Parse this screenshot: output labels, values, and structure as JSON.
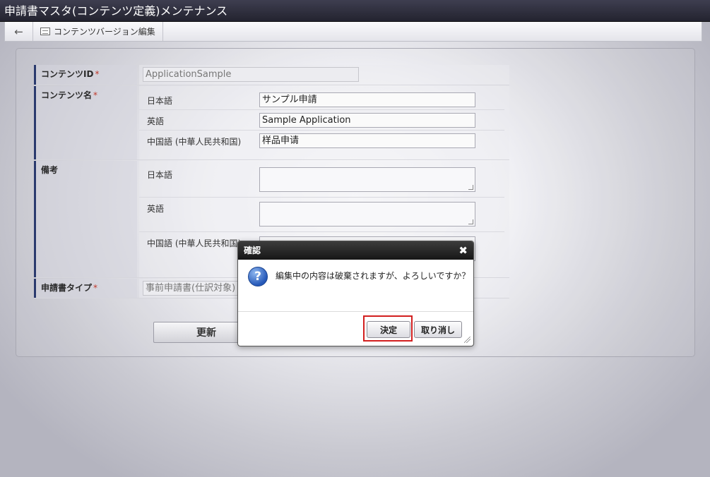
{
  "window": {
    "title": "申請書マスタ(コンテンツ定義)メンテナンス"
  },
  "toolbar": {
    "back_icon": "←",
    "tab_label": "コンテンツバージョン編集"
  },
  "form": {
    "content_id": {
      "label": "コンテンツID",
      "required_mark": "*",
      "value": "ApplicationSample"
    },
    "content_name": {
      "label": "コンテンツ名",
      "required_mark": "*",
      "langs": [
        {
          "label": "日本語",
          "value": "サンプル申請"
        },
        {
          "label": "英語",
          "value": "Sample Application"
        },
        {
          "label": "中国語 (中華人民共和国)",
          "value": "样品申请"
        }
      ]
    },
    "remarks": {
      "label": "備考",
      "langs": [
        {
          "label": "日本語"
        },
        {
          "label": "英語"
        },
        {
          "label": "中国語 (中華人民共和国)"
        }
      ]
    },
    "app_type": {
      "label": "申請書タイプ",
      "required_mark": "*",
      "value": "事前申請書(仕訳対象)"
    },
    "update_label": "更新"
  },
  "dialog": {
    "title": "確認",
    "close_icon": "✖",
    "icon": "?",
    "message": "編集中の内容は破棄されますが、よろしいですか？",
    "ok_label": "決定",
    "cancel_label": "取り消し"
  }
}
